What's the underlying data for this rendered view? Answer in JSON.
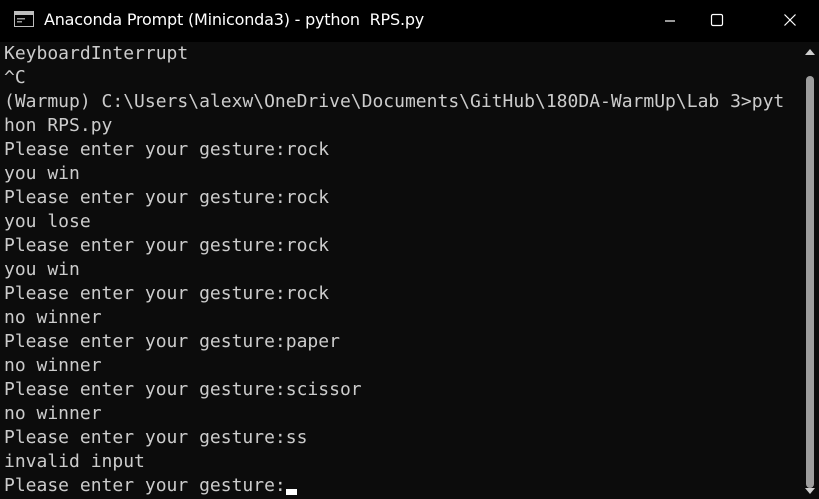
{
  "window": {
    "title": "Anaconda Prompt (Miniconda3) - python  RPS.py",
    "app_icon": "console-window-icon",
    "controls": {
      "minimize_icon": "minimize-icon",
      "maximize_icon": "maximize-icon",
      "close_icon": "close-icon"
    }
  },
  "terminal": {
    "lines": [
      "KeyboardInterrupt",
      "^C",
      "(Warmup) C:\\Users\\alexw\\OneDrive\\Documents\\GitHub\\180DA-WarmUp\\Lab 3>pyt",
      "hon RPS.py",
      "Please enter your gesture:rock",
      "you win",
      "Please enter your gesture:rock",
      "you lose",
      "Please enter your gesture:rock",
      "you win",
      "Please enter your gesture:rock",
      "no winner",
      "Please enter your gesture:paper",
      "no winner",
      "Please enter your gesture:scissor",
      "no winner",
      "Please enter your gesture:ss",
      "invalid input",
      "Please enter your gesture:"
    ],
    "colors": {
      "background": "#0c0c0c",
      "text": "#cccccc",
      "cursor": "#ffffff"
    }
  },
  "scrollbar": {
    "up_icon": "scroll-up-arrow-icon",
    "down_icon": "scroll-down-arrow-icon"
  }
}
